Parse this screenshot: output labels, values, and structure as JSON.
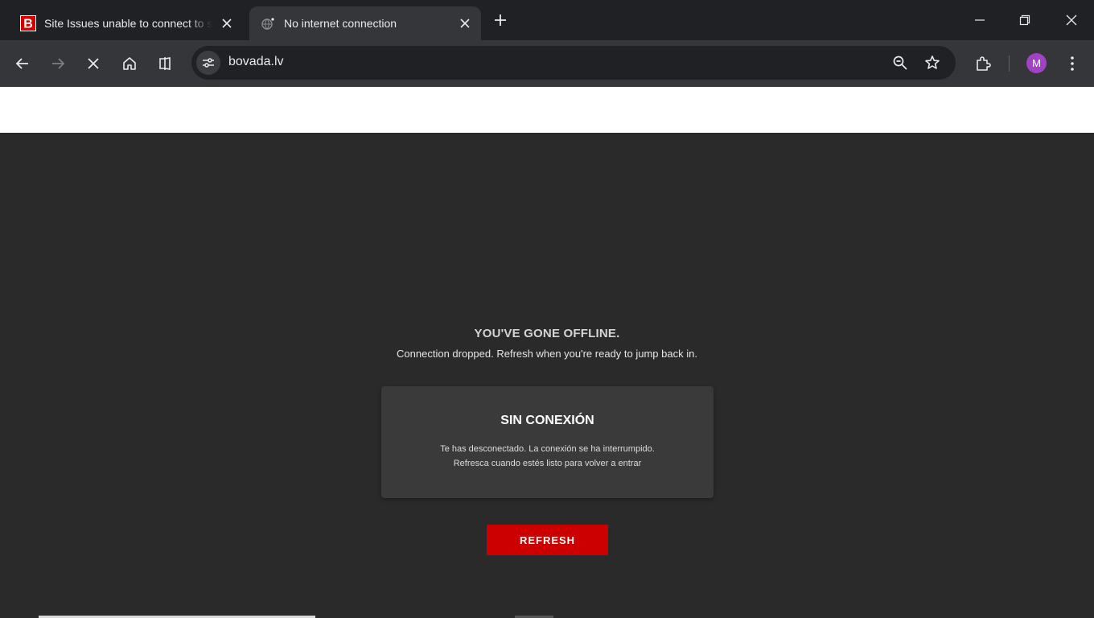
{
  "tabs": [
    {
      "title": "Site Issues unable to connect to site",
      "active": false
    },
    {
      "title": "No internet connection",
      "active": true
    }
  ],
  "omnibox": {
    "url": "bovada.lv"
  },
  "profile": {
    "initial": "M",
    "color": "#a142c4"
  },
  "page": {
    "heading": "YOU'VE GONE OFFLINE.",
    "subtext": "Connection dropped. Refresh when you're ready to jump back in.",
    "card": {
      "title": "SIN CONEXIÓN",
      "line1": "Te has desconectado. La conexión se ha interrumpido.",
      "line2": "Refresca cuando estés listo para volver a entrar"
    },
    "refresh_label": "REFRESH"
  },
  "icons": {
    "tab1_favicon": "bovada-b-icon",
    "tab2_favicon": "offline-globe-icon",
    "toolbar": [
      "back-arrow-icon",
      "forward-arrow-icon",
      "stop-icon",
      "home-icon",
      "split-view-icon"
    ],
    "omnibox": [
      "site-info-icon",
      "zoom-icon",
      "bookmark-star-icon"
    ],
    "right": [
      "extensions-icon",
      "kebab-menu-icon"
    ]
  },
  "colors": {
    "brand_red": "#cc0000",
    "page_bg": "#2a2a2a",
    "card_bg": "#3a3a3a"
  }
}
